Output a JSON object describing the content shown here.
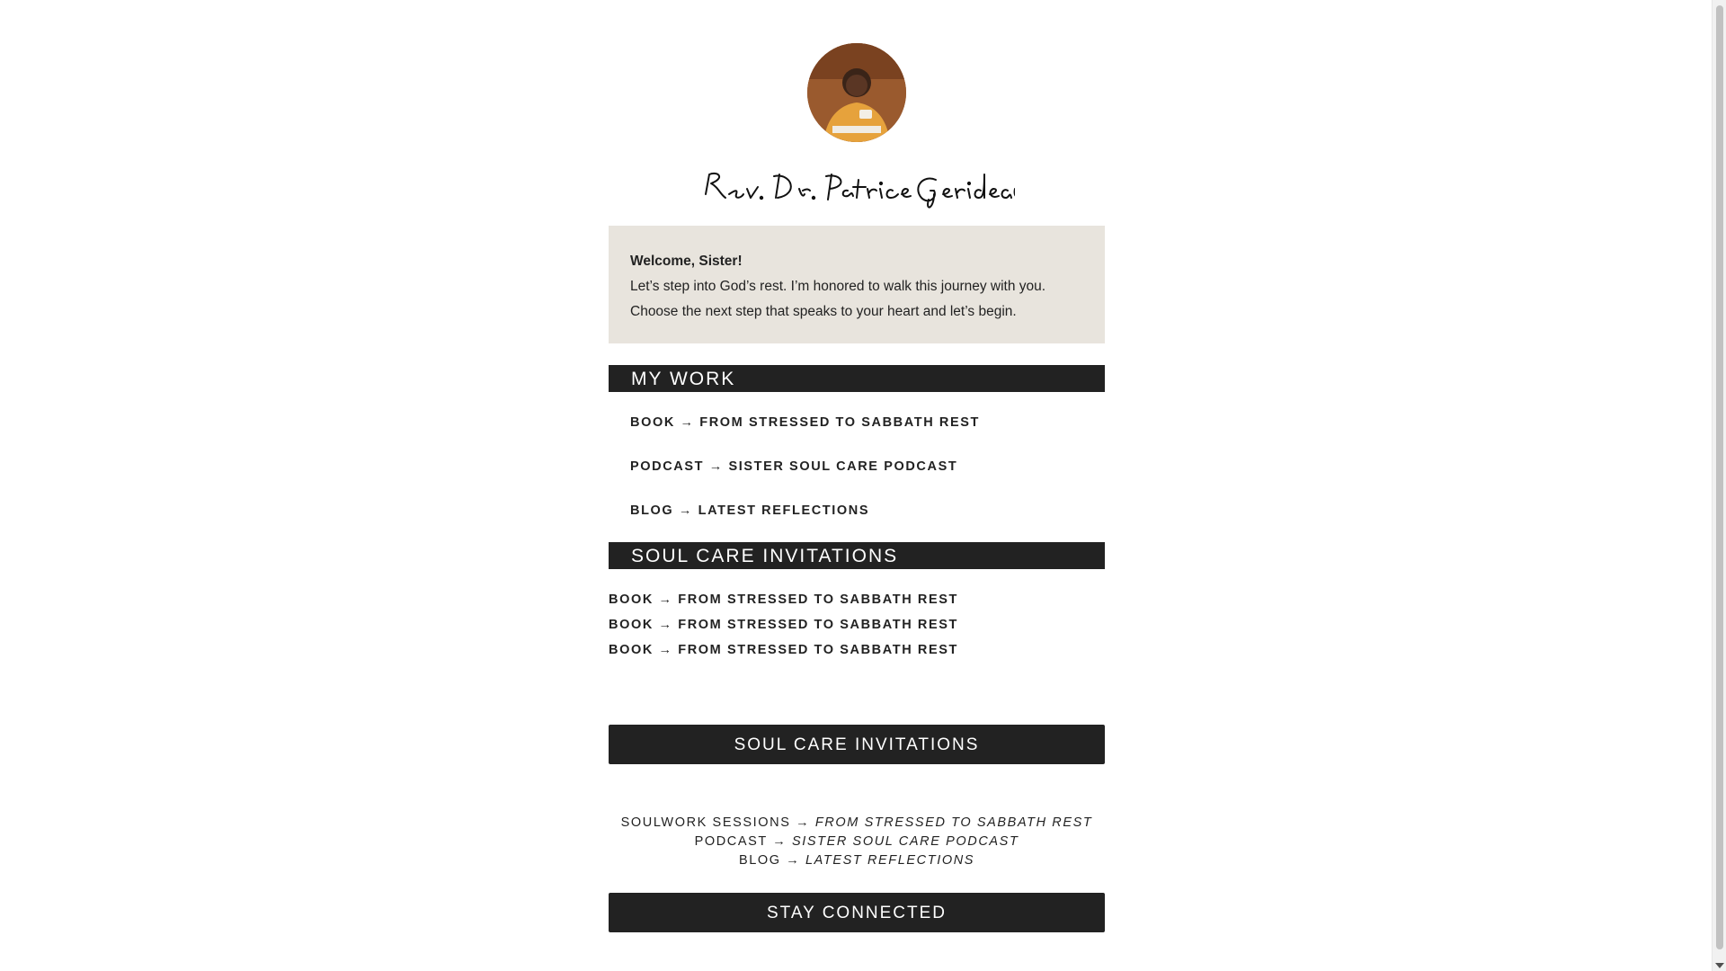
{
  "profile": {
    "avatar_icon": "portrait-photo",
    "signature_text": "Rev. Dr. Patrice Gerideau"
  },
  "welcome": {
    "greeting": "Welcome, Sister!",
    "message": "Let’s step into God’s rest. I’m honored to walk this journey with you. Choose the next step that speaks to your heart and let’s begin."
  },
  "my_work": {
    "heading": "MY WORK",
    "links": [
      "BOOK → FROM STRESSED TO SABBATH REST",
      "PODCAST → SISTER SOUL CARE PODCAST",
      "BLOG → LATEST REFLECTIONS"
    ]
  },
  "soul_care": {
    "heading": "SOUL CARE INVITATIONS",
    "links": [
      "BOOK → FROM STRESSED TO SABBATH REST",
      "BOOK → FROM STRESSED TO SABBATH REST",
      "BOOK → FROM STRESSED TO SABBATH REST"
    ]
  },
  "soul_care_2": {
    "heading": "SOUL CARE INVITATIONS",
    "lines": [
      {
        "prefix": "SOULWORK SESSIONS → ",
        "title": "FROM STRESSED TO SABBATH REST"
      },
      {
        "prefix": "PODCAST → ",
        "title": "SISTER SOUL CARE PODCAST"
      },
      {
        "prefix": "BLOG → ",
        "title": "LATEST REFLECTIONS"
      }
    ]
  },
  "stay_connected": {
    "heading": "STAY CONNECTED"
  },
  "colors": {
    "background": "#ffffff",
    "panel": "#e8e4dd",
    "bar": "#222222",
    "text": "#222222"
  }
}
